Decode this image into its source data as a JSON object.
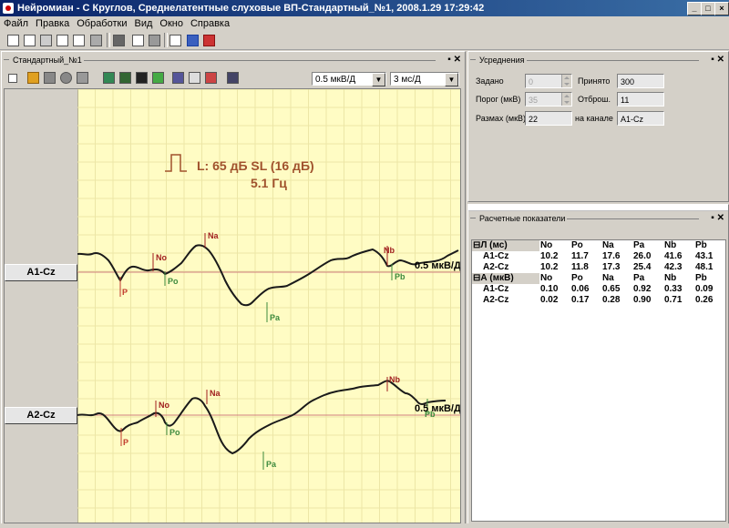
{
  "window": {
    "title": "Нейромиан - С Круглов, Среднелатентные слуховые ВП-Стандартный_№1, 2008.1.29 17:29:42",
    "controls": [
      "_",
      "□",
      "×"
    ]
  },
  "menu": [
    "Файл",
    "Правка",
    "Обработки",
    "Вид",
    "Окно",
    "Справка"
  ],
  "main_toolbar_icons": [
    "new-doc-icon",
    "open-doc-icon",
    "save-icon",
    "print-icon",
    "print-preview-icon",
    "acquire-icon",
    "print2-icon",
    "report-icon",
    "export-icon",
    "grid-icon",
    "delete-icon"
  ],
  "left_panel": {
    "title": "Стандартный_№1",
    "toolbar_icons": [
      "expand-icon",
      "stimulus-icon",
      "forward-icon",
      "record-icon",
      "filter-icon",
      "peaks-a-icon",
      "peaks-b-icon",
      "peaks-c-icon",
      "peaks-d-icon",
      "grid-toggle-icon",
      "wave-icon",
      "reject-icon",
      "settings-icon"
    ],
    "gain": {
      "value": "0.5 мкВ/Д"
    },
    "sweep": {
      "value": "3 мс/Д"
    },
    "stim_label": "L: 65 дБ SL (16 дБ)",
    "stim_rate": "5.1 Гц",
    "channels": [
      {
        "name": "A1-Cz",
        "scale_label": "0.5 мкВ/Д",
        "markers": [
          {
            "label": "P",
            "color": "#c0392b"
          },
          {
            "label": "No",
            "color": "#a01e1e"
          },
          {
            "label": "Po",
            "color": "#3d8a3d"
          },
          {
            "label": "Na",
            "color": "#a01e1e"
          },
          {
            "label": "Pa",
            "color": "#3d8a3d"
          },
          {
            "label": "Nb",
            "color": "#a01e1e"
          },
          {
            "label": "Pb",
            "color": "#3d8a3d"
          }
        ]
      },
      {
        "name": "A2-Cz",
        "scale_label": "0.5 мкВ/Д",
        "markers": [
          {
            "label": "P",
            "color": "#c0392b"
          },
          {
            "label": "No",
            "color": "#a01e1e"
          },
          {
            "label": "Po",
            "color": "#3d8a3d"
          },
          {
            "label": "Na",
            "color": "#a01e1e"
          },
          {
            "label": "Pa",
            "color": "#3d8a3d"
          },
          {
            "label": "Nb",
            "color": "#a01e1e"
          },
          {
            "label": "Pb",
            "color": "#3d8a3d"
          }
        ]
      }
    ]
  },
  "averaging": {
    "title": "Усреднения",
    "fields": {
      "zadano": {
        "label": "Задано",
        "value": "0"
      },
      "prinyato": {
        "label": "Принято",
        "value": "300"
      },
      "porog": {
        "label": "Порог (мкВ)",
        "value": "35"
      },
      "otbrosh": {
        "label": "Отброш.",
        "value": "11"
      },
      "razmah": {
        "label": "Размах (мкВ)",
        "value": "22"
      },
      "kanal": {
        "label": "на канале",
        "value": "A1-Cz"
      }
    }
  },
  "calc": {
    "title": "Расчетные показатели",
    "groups": [
      {
        "label": "Л (мс)",
        "headers": [
          "No",
          "Po",
          "Na",
          "Pa",
          "Nb",
          "Pb"
        ],
        "rows": [
          {
            "ch": "A1-Cz",
            "vals": [
              "10.2",
              "11.7",
              "17.6",
              "26.0",
              "41.6",
              "43.1"
            ]
          },
          {
            "ch": "A2-Cz",
            "vals": [
              "10.2",
              "11.8",
              "17.3",
              "25.4",
              "42.3",
              "48.1"
            ]
          }
        ]
      },
      {
        "label": "А (мкВ)",
        "headers": [
          "No",
          "Po",
          "Na",
          "Pa",
          "Nb",
          "Pb"
        ],
        "rows": [
          {
            "ch": "A1-Cz",
            "vals": [
              "0.10",
              "0.06",
              "0.65",
              "0.92",
              "0.33",
              "0.09"
            ]
          },
          {
            "ch": "A2-Cz",
            "vals": [
              "0.02",
              "0.17",
              "0.28",
              "0.90",
              "0.71",
              "0.26"
            ]
          }
        ]
      }
    ]
  }
}
